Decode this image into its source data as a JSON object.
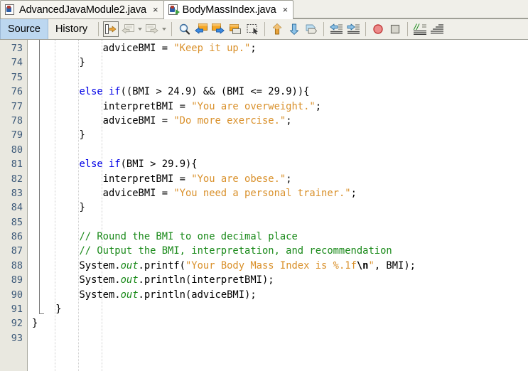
{
  "tabs": [
    {
      "label": "AdvancedJavaModule2.java",
      "close": "×",
      "active": false,
      "icon": "java-file-icon"
    },
    {
      "label": "BodyMassIndex.java",
      "close": "×",
      "active": true,
      "icon": "java-main-file-icon"
    }
  ],
  "toolbar": {
    "source_label": "Source",
    "history_label": "History",
    "buttons": [
      {
        "name": "last-edit-icon",
        "title": "Last Edit"
      },
      {
        "name": "back-icon",
        "title": "Back"
      },
      {
        "name": "back-dropdown-icon",
        "title": "Back History"
      },
      {
        "name": "forward-icon",
        "title": "Forward"
      },
      {
        "name": "forward-dropdown-icon",
        "title": "Forward History"
      },
      {
        "name": "find-selection-icon",
        "title": "Find Selection"
      },
      {
        "name": "find-previous-icon",
        "title": "Find Previous"
      },
      {
        "name": "find-next-icon",
        "title": "Find Next"
      },
      {
        "name": "toggle-rectangular-selection-icon",
        "title": "Toggle Rectangular Selection"
      },
      {
        "name": "previous-bookmark-icon",
        "title": "Previous Bookmark"
      },
      {
        "name": "next-bookmark-icon",
        "title": "Next Bookmark"
      },
      {
        "name": "toggle-bookmark-icon",
        "title": "Toggle Bookmark"
      },
      {
        "name": "shift-left-icon",
        "title": "Shift Line Left"
      },
      {
        "name": "shift-right-icon",
        "title": "Shift Line Right"
      },
      {
        "name": "toggle-breakpoint-icon",
        "title": "Toggle Breakpoint"
      },
      {
        "name": "stop-icon",
        "title": "Stop"
      },
      {
        "name": "comment-icon",
        "title": "Comment"
      },
      {
        "name": "uncomment-icon",
        "title": "Uncomment"
      }
    ]
  },
  "editor": {
    "first_line_number": 73,
    "line_numbers": [
      73,
      74,
      75,
      76,
      77,
      78,
      79,
      80,
      81,
      82,
      83,
      84,
      85,
      86,
      87,
      88,
      89,
      90,
      91,
      92,
      93
    ],
    "lines": [
      {
        "n": 73,
        "tokens": [
          {
            "t": "            adviceBMI = ",
            "c": "pln"
          },
          {
            "t": "\"Keep it up.\"",
            "c": "str"
          },
          {
            "t": ";",
            "c": "pln"
          }
        ]
      },
      {
        "n": 74,
        "tokens": [
          {
            "t": "        }",
            "c": "pln"
          }
        ]
      },
      {
        "n": 75,
        "tokens": [
          {
            "t": "",
            "c": "pln"
          }
        ]
      },
      {
        "n": 76,
        "tokens": [
          {
            "t": "        ",
            "c": "pln"
          },
          {
            "t": "else",
            "c": "kw"
          },
          {
            "t": " ",
            "c": "pln"
          },
          {
            "t": "if",
            "c": "kw"
          },
          {
            "t": "((BMI > 24.9) && (BMI <= 29.9)){",
            "c": "pln"
          }
        ]
      },
      {
        "n": 77,
        "tokens": [
          {
            "t": "            interpretBMI = ",
            "c": "pln"
          },
          {
            "t": "\"You are overweight.\"",
            "c": "str"
          },
          {
            "t": ";",
            "c": "pln"
          }
        ]
      },
      {
        "n": 78,
        "tokens": [
          {
            "t": "            adviceBMI = ",
            "c": "pln"
          },
          {
            "t": "\"Do more exercise.\"",
            "c": "str"
          },
          {
            "t": ";",
            "c": "pln"
          }
        ]
      },
      {
        "n": 79,
        "tokens": [
          {
            "t": "        }",
            "c": "pln"
          }
        ]
      },
      {
        "n": 80,
        "tokens": [
          {
            "t": "",
            "c": "pln"
          }
        ]
      },
      {
        "n": 81,
        "tokens": [
          {
            "t": "        ",
            "c": "pln"
          },
          {
            "t": "else",
            "c": "kw"
          },
          {
            "t": " ",
            "c": "pln"
          },
          {
            "t": "if",
            "c": "kw"
          },
          {
            "t": "(BMI > 29.9){",
            "c": "pln"
          }
        ]
      },
      {
        "n": 82,
        "tokens": [
          {
            "t": "            interpretBMI = ",
            "c": "pln"
          },
          {
            "t": "\"You are obese.\"",
            "c": "str"
          },
          {
            "t": ";",
            "c": "pln"
          }
        ]
      },
      {
        "n": 83,
        "tokens": [
          {
            "t": "            adviceBMI = ",
            "c": "pln"
          },
          {
            "t": "\"You need a personal trainer.\"",
            "c": "str"
          },
          {
            "t": ";",
            "c": "pln"
          }
        ]
      },
      {
        "n": 84,
        "tokens": [
          {
            "t": "        }",
            "c": "pln"
          }
        ]
      },
      {
        "n": 85,
        "tokens": [
          {
            "t": "",
            "c": "pln"
          }
        ]
      },
      {
        "n": 86,
        "tokens": [
          {
            "t": "        ",
            "c": "pln"
          },
          {
            "t": "// Round the BMI to one decimal place",
            "c": "cmt"
          }
        ]
      },
      {
        "n": 87,
        "tokens": [
          {
            "t": "        ",
            "c": "pln"
          },
          {
            "t": "// Output the BMI, interpretation, and recommendation",
            "c": "cmt"
          }
        ]
      },
      {
        "n": 88,
        "tokens": [
          {
            "t": "        System.",
            "c": "pln"
          },
          {
            "t": "out",
            "c": "fld"
          },
          {
            "t": ".printf(",
            "c": "pln"
          },
          {
            "t": "\"Your Body Mass Index is %.1f",
            "c": "str"
          },
          {
            "t": "\\n",
            "c": "esc"
          },
          {
            "t": "\"",
            "c": "str"
          },
          {
            "t": ", BMI);",
            "c": "pln"
          }
        ]
      },
      {
        "n": 89,
        "tokens": [
          {
            "t": "        System.",
            "c": "pln"
          },
          {
            "t": "out",
            "c": "fld"
          },
          {
            "t": ".println(interpretBMI);",
            "c": "pln"
          }
        ]
      },
      {
        "n": 90,
        "tokens": [
          {
            "t": "        System.",
            "c": "pln"
          },
          {
            "t": "out",
            "c": "fld"
          },
          {
            "t": ".println(adviceBMI);",
            "c": "pln"
          }
        ]
      },
      {
        "n": 91,
        "tokens": [
          {
            "t": "    }",
            "c": "pln"
          }
        ]
      },
      {
        "n": 92,
        "tokens": [
          {
            "t": "}",
            "c": "pln"
          }
        ]
      },
      {
        "n": 93,
        "tokens": [
          {
            "t": "",
            "c": "pln"
          }
        ]
      }
    ]
  },
  "colors": {
    "keyword": "#0000e6",
    "string": "#d9902a",
    "comment": "#1a8a1a",
    "field": "#1a8a1a",
    "gutter_bg": "#e9e8e0",
    "gutter_text": "#3b5878",
    "chrome_bg": "#f0efe9",
    "active_tab_bg": "#ffffff",
    "source_toggle_bg": "#bcd7f0"
  }
}
